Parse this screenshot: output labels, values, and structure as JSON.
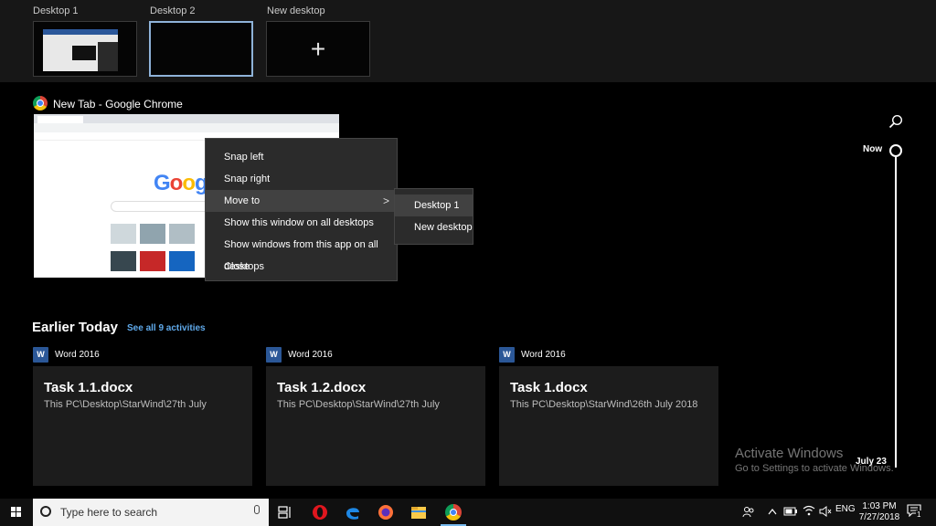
{
  "desktops": [
    {
      "label": "Desktop 1",
      "active": false
    },
    {
      "label": "Desktop 2",
      "active": true
    },
    {
      "label": "New desktop",
      "active": false
    }
  ],
  "new_desktop_symbol": "+",
  "window": {
    "title": "New Tab - Google Chrome",
    "icon": "chrome-icon",
    "logo_text": "Google"
  },
  "context_menu": {
    "items": [
      "Snap left",
      "Snap right",
      "Move to",
      "Show this window on all desktops",
      "Show windows from this app on all desktops",
      "Close"
    ],
    "highlighted": "Move to",
    "chevron": ">"
  },
  "submenu": {
    "items": [
      "Desktop 1",
      "New desktop"
    ],
    "highlighted": "Desktop 1"
  },
  "timeline": {
    "now_label": "Now",
    "date_label": "July 23"
  },
  "earlier_today": {
    "title": "Earlier Today",
    "see_all": "See all 9 activities",
    "cards": [
      {
        "app": "Word 2016",
        "app_icon_letter": "W",
        "title": "Task 1.1.docx",
        "path": "This PC\\Desktop\\StarWind\\27th July"
      },
      {
        "app": "Word 2016",
        "app_icon_letter": "W",
        "title": "Task 1.2.docx",
        "path": "This PC\\Desktop\\StarWind\\27th July"
      },
      {
        "app": "Word 2016",
        "app_icon_letter": "W",
        "title": "Task 1.docx",
        "path": "This PC\\Desktop\\StarWind\\26th July 2018"
      }
    ]
  },
  "watermark": {
    "line1": "Activate Windows",
    "line2": "Go to Settings to activate Windows."
  },
  "taskbar": {
    "search_placeholder": "Type here to search",
    "apps": [
      "task-view-icon",
      "opera-icon",
      "edge-icon",
      "firefox-icon",
      "file-explorer-icon",
      "chrome-icon"
    ],
    "active_app": "chrome-icon",
    "tray": {
      "language": "ENG",
      "time": "1:03 PM",
      "date": "7/27/2018",
      "notification_count": "1"
    }
  },
  "colors": {
    "accent": "#8fb3d9",
    "link": "#5fa9ea",
    "word_blue": "#2b5797",
    "menu_bg": "#2b2b2b"
  }
}
